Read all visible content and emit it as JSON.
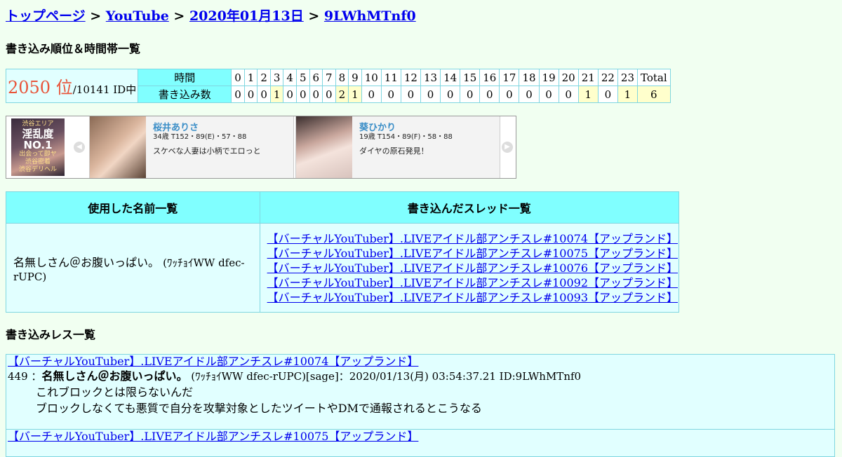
{
  "breadcrumb": {
    "top": "トップページ",
    "site": "YouTube",
    "date": "2020年01月13日",
    "id": "9LWhMTnf0",
    "sep": ">"
  },
  "sections": {
    "rank_title": "書き込み順位＆時間帯一覧",
    "posts_title": "書き込みレス一覧"
  },
  "rank": {
    "position": "2050 位",
    "total": "/10141 ID中",
    "row_time_label": "時間",
    "row_count_label": "書き込み数",
    "hours": [
      "0",
      "1",
      "2",
      "3",
      "4",
      "5",
      "6",
      "7",
      "8",
      "9",
      "10",
      "11",
      "12",
      "13",
      "14",
      "15",
      "16",
      "17",
      "18",
      "19",
      "20",
      "21",
      "22",
      "23",
      "Total"
    ],
    "counts": [
      "0",
      "0",
      "0",
      "1",
      "0",
      "0",
      "0",
      "0",
      "2",
      "1",
      "0",
      "0",
      "0",
      "0",
      "0",
      "0",
      "0",
      "0",
      "0",
      "0",
      "0",
      "1",
      "0",
      "1",
      "6"
    ]
  },
  "ad": {
    "banner_lines": [
      "渋谷エリア",
      "淫乱度NO.1",
      "出会って即ヤ",
      "渋谷密着",
      "渋谷デリヘル"
    ],
    "left_arrow": "◀",
    "right_arrow": "▶",
    "cards": [
      {
        "name": "桜井ありさ",
        "stats": "34歳 T152・89(E)・57・88",
        "desc": "スケベな人妻は小柄でエロっと"
      },
      {
        "name": "葵ひかり",
        "stats": "19歳 T154・89(F)・58・88",
        "desc": "ダイヤの原石発見！"
      }
    ]
  },
  "names_table": {
    "col_names": "使用した名前一覧",
    "col_threads": "書き込んだスレッド一覧",
    "name": "名無しさん＠お腹いっぱい。",
    "trip": "(ﾜｯﾁｮｲWW dfec-rUPC)",
    "threads": [
      "【バーチャルYouTuber】.LIVEアイドル部アンチスレ#10074【アップランド】",
      "【バーチャルYouTuber】.LIVEアイドル部アンチスレ#10075【アップランド】",
      "【バーチャルYouTuber】.LIVEアイドル部アンチスレ#10076【アップランド】",
      "【バーチャルYouTuber】.LIVEアイドル部アンチスレ#10092【アップランド】",
      "【バーチャルYouTuber】.LIVEアイドル部アンチスレ#10093【アップランド】"
    ]
  },
  "posts": [
    {
      "thread": "【バーチャルYouTuber】.LIVEアイドル部アンチスレ#10074【アップランド】",
      "num": "449",
      "sep": "：",
      "name": "名無しさん＠お腹いっぱい。",
      "meta": "(ﾜｯﾁｮｲWW dfec-rUPC)[sage]：2020/01/13(月) 03:54:37.21 ID:9LWhMTnf0",
      "lines": [
        "これブロックとは限らないんだ⁠",
        "ブロックしなくても悪質で自分を攻撃対象としたツイートやDMで通報されるとこうなる"
      ]
    },
    {
      "thread": "【バーチャルYouTuber】.LIVEアイドル部アンチスレ#10075【アップランド】"
    }
  ],
  "colors": {
    "header_cyan": "#80ffff",
    "cell_cyan": "#e1ffff",
    "highlight_yellow": "#ffffcc",
    "rank_red": "#e8543a",
    "page_bg": "#f1fff1"
  }
}
